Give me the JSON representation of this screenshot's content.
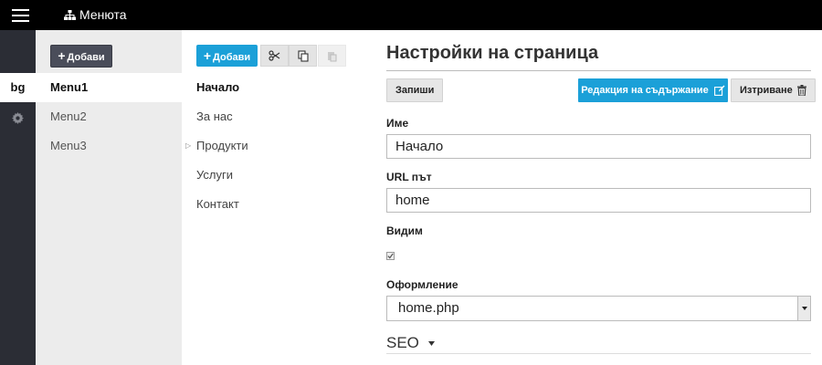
{
  "topbar": {
    "title": "Менюта"
  },
  "lang": {
    "current": "bg"
  },
  "menus": {
    "add_label": "Добави",
    "items": [
      "Menu1",
      "Menu2",
      "Menu3"
    ]
  },
  "pages": {
    "add_label": "Добави",
    "items": [
      "Начало",
      "За нас",
      "Продукти",
      "Услуги",
      "Контакт"
    ]
  },
  "settings": {
    "title": "Настройки на страница",
    "save_label": "Запиши",
    "edit_content_label": "Редакция на съдържание",
    "delete_label": "Изтриване",
    "name_label": "Име",
    "name_value": "Начало",
    "url_label": "URL път",
    "url_value": "home",
    "visible_label": "Видим",
    "visible_checked": true,
    "layout_label": "Оформление",
    "layout_value": "home.php",
    "seo_label": "SEO"
  },
  "colors": {
    "accent": "#1ba0d8",
    "dark_button": "#4a4d5a",
    "topbar": "#000000",
    "lang_strip": "#2b2d35"
  },
  "icons": [
    "hamburger-icon",
    "sitemap-icon",
    "gear-icon",
    "plus-icon",
    "scissors-icon",
    "copy-icon",
    "paste-icon",
    "edit-icon",
    "trash-icon",
    "caret-right-icon",
    "caret-down-icon",
    "checkmark-icon"
  ]
}
